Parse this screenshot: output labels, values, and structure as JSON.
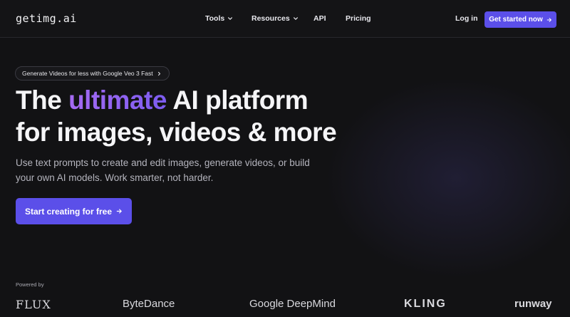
{
  "nav": {
    "logo": "getimg.ai",
    "links": [
      {
        "label": "Tools",
        "has_dropdown": true
      },
      {
        "label": "Resources",
        "has_dropdown": true
      },
      {
        "label": "API",
        "has_dropdown": false
      },
      {
        "label": "Pricing",
        "has_dropdown": false
      }
    ],
    "login": "Log in",
    "cta": "Get started now"
  },
  "hero": {
    "pill": "Generate Videos for less with Google Veo 3 Fast",
    "headline_pre": "The ",
    "headline_accent": "ultimate",
    "headline_post_line1": " AI platform",
    "headline_line2": "for images, videos & more",
    "subtext": "Use text prompts to create and edit images, generate videos, or build your own AI models. Work smarter, not harder.",
    "cta": "Start creating for free"
  },
  "powered_by": {
    "label": "Powered by",
    "brands": [
      "FLUX",
      "ByteDance",
      "Google DeepMind",
      "KLING",
      "runway"
    ]
  },
  "colors": {
    "background": "#121214",
    "accent": "#5b4fe9",
    "headline_gradient_start": "#a66bf2",
    "headline_gradient_end": "#7c5cf0"
  },
  "icons": [
    "chevron-down-icon",
    "arrow-right-icon",
    "chevron-right-icon"
  ]
}
